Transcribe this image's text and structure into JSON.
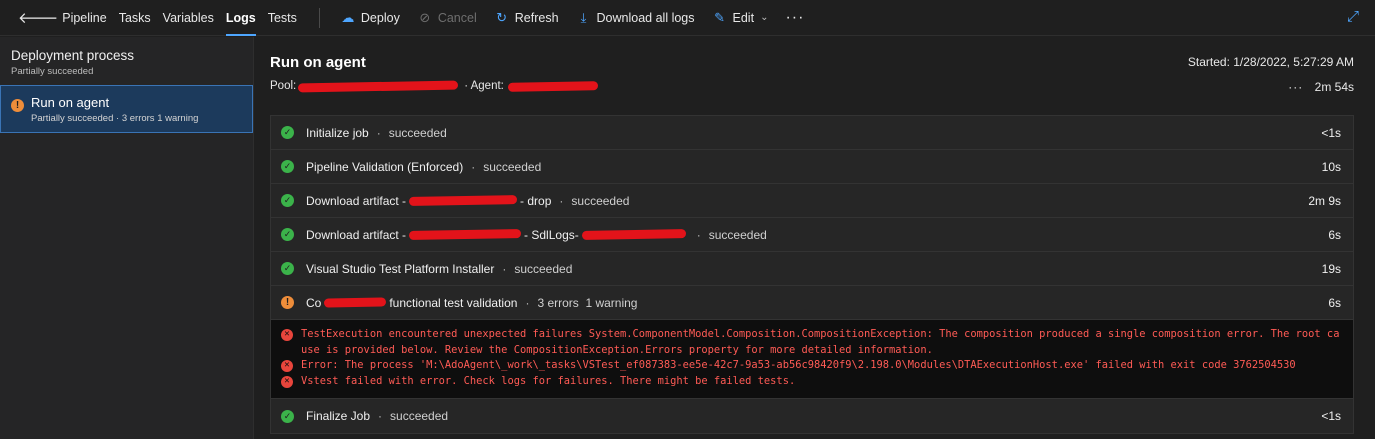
{
  "topbar": {
    "pipeline_label": "Pipeline",
    "tabs": [
      "Tasks",
      "Variables",
      "Logs",
      "Tests"
    ],
    "active_tab": "Logs",
    "deploy_label": "Deploy",
    "cancel_label": "Cancel",
    "refresh_label": "Refresh",
    "download_label": "Download all logs",
    "edit_label": "Edit",
    "more_label": "···"
  },
  "sidebar": {
    "header_title": "Deployment process",
    "header_status": "Partially succeeded",
    "item_title": "Run on agent",
    "item_status": "Partially succeeded · 3 errors 1 warning"
  },
  "main": {
    "title": "Run on agent",
    "started": "Started: 1/28/2022, 5:27:29 AM",
    "pool_label": "Pool:",
    "agent_label": "· Agent:",
    "more_label": "···",
    "duration": "2m 54s",
    "dot_sep": "·"
  },
  "steps": [
    {
      "name": "Initialize job",
      "status": "succeeded",
      "duration": "<1s"
    },
    {
      "name": "Pipeline Validation (Enforced)",
      "status": "succeeded",
      "duration": "10s"
    },
    {
      "name_prefix": "Download artifact -",
      "name_suffix": "- drop",
      "status": "succeeded",
      "duration": "2m 9s"
    },
    {
      "name_prefix": "Download artifact -",
      "name_suffix": "- SdlLogs-",
      "status": "succeeded",
      "duration": "6s"
    },
    {
      "name": "Visual Studio Test Platform Installer",
      "status": "succeeded",
      "duration": "19s"
    },
    {
      "name_prefix": "Co",
      "name_suffix": "functional test validation",
      "status": "3 errors  1 warning",
      "duration": "6s"
    },
    {
      "name": "Finalize Job",
      "status": "succeeded",
      "duration": "<1s"
    }
  ],
  "errors": [
    "TestExecution encountered unexpected failures System.ComponentModel.Composition.CompositionException: The composition produced a single composition error. The root cause is provided below. Review the CompositionException.Errors property for more detailed information.",
    "Error: The process 'M:\\AdoAgent\\_work\\_tasks\\VSTest_ef087383-ee5e-42c7-9a53-ab56c98420f9\\2.198.0\\Modules\\DTAExecutionHost.exe' failed with exit code 3762504530",
    "Vstest failed with error. Check logs for failures. There might be failed tests."
  ],
  "colors": {
    "accent": "#4ea6ff",
    "success": "#3bb34a",
    "warning": "#ee8d3a",
    "error": "#ff5b55",
    "redaction": "#e3131a"
  },
  "icons": {
    "back": "arrow-left-icon",
    "deploy": "cloud-icon",
    "cancel": "cancel-icon",
    "refresh": "refresh-icon",
    "download": "download-icon",
    "edit": "pencil-icon",
    "expand": "expand-icon"
  }
}
